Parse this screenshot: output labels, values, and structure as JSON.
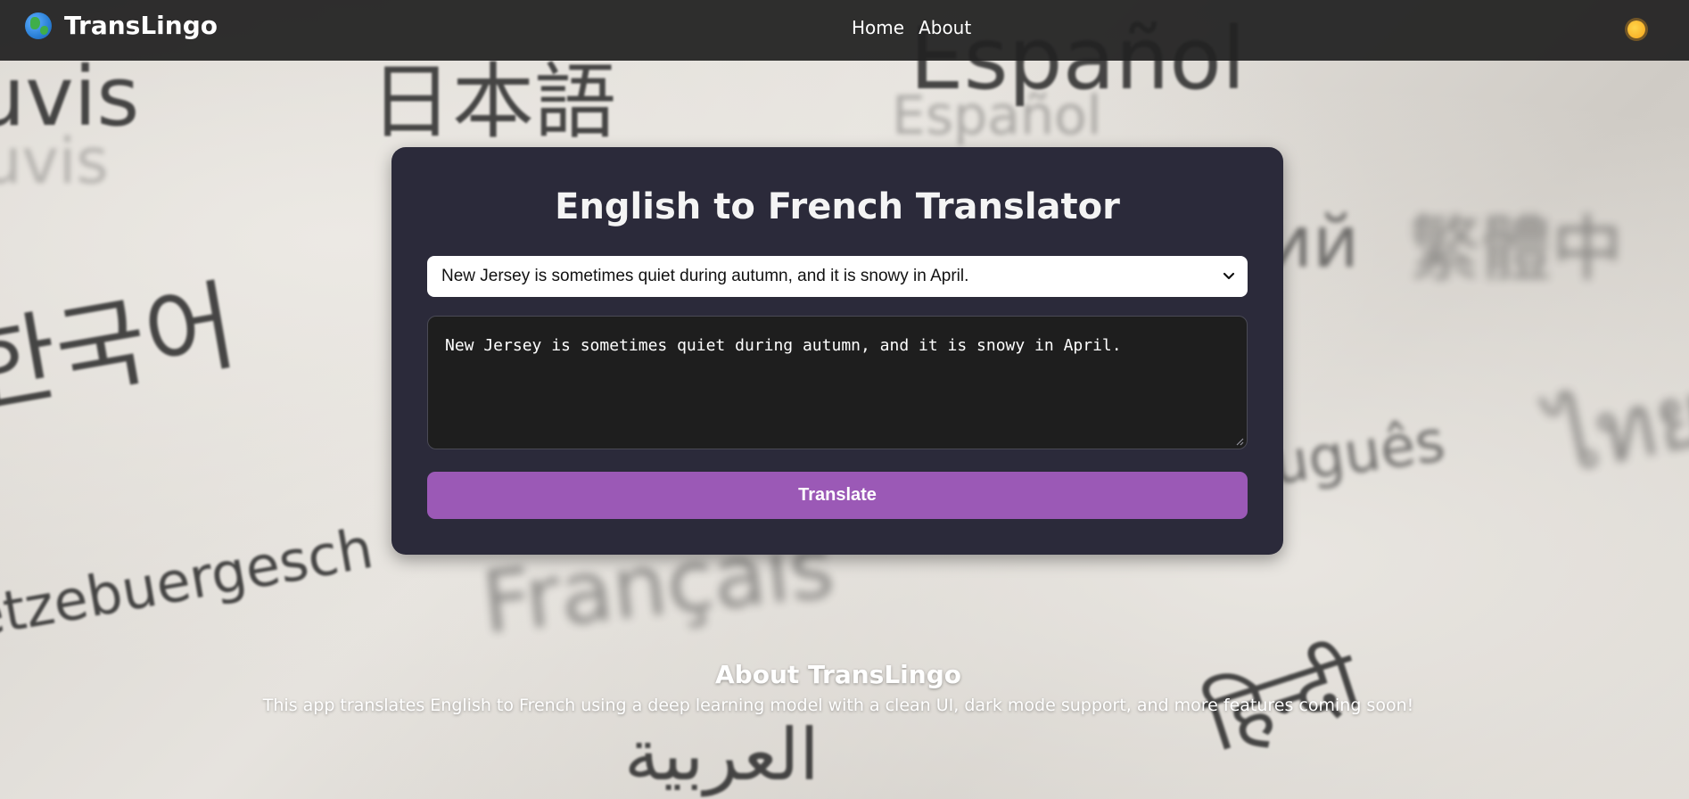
{
  "navbar": {
    "logo_icon": "globe-icon",
    "brand": "TransLingo",
    "links": [
      "Home",
      "About"
    ],
    "theme_toggle_icon": "sun-icon"
  },
  "translator": {
    "title": "English to French Translator",
    "selected_sentence": "New Jersey is sometimes quiet during autumn, and it is snowy in April.",
    "input_text": "New Jersey is sometimes quiet during autumn, and it is snowy in April.",
    "button_label": "Translate"
  },
  "about": {
    "title": "About TransLingo",
    "text": "This app translates English to French using a deep learning model with a clean UI, dark mode support, and more features coming soon!"
  },
  "background_words": [
    "uvis",
    "日本語",
    "Español",
    "한국어",
    "ий",
    "繁體中",
    "Português",
    "ไทย",
    "Lëtzebuergesch",
    "Français",
    "हिन्दी",
    "العربية"
  ],
  "colors": {
    "navbar_bg": "#222222",
    "card_bg": "#2b2a3a",
    "input_bg": "#1e1e1e",
    "button_bg": "#9b59b6",
    "text": "#ffffff"
  }
}
